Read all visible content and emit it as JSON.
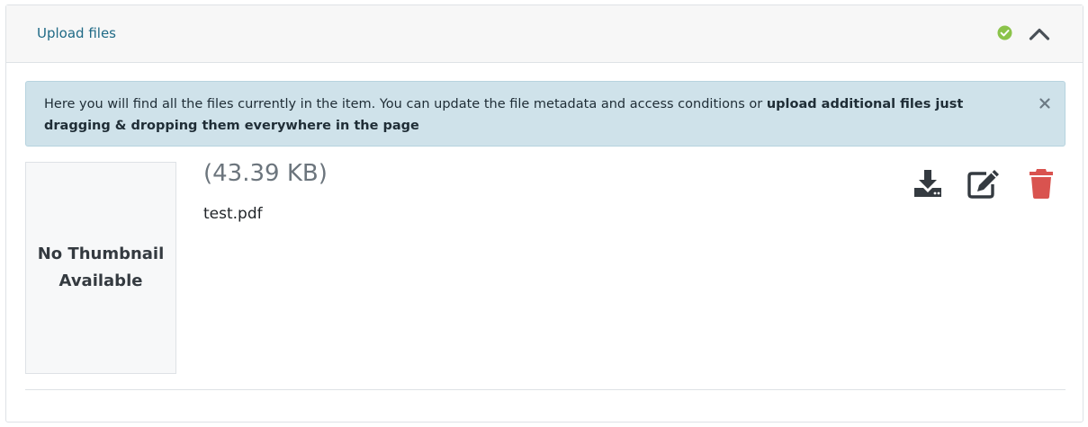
{
  "header": {
    "title": "Upload files",
    "status_icon": "check-circle-icon",
    "status_color": "#8bc34a",
    "collapse_icon": "chevron-up-icon"
  },
  "alert": {
    "text_normal": "Here you will find all the files currently in the item. You can update the file metadata and access conditions or ",
    "text_bold": "upload additional files just dragging & dropping them everywhere in the page",
    "close_icon": "close-icon",
    "background": "#cfe2ea"
  },
  "file": {
    "thumbnail_line1": "No Thumbnail",
    "thumbnail_line2": "Available",
    "size": "(43.39 KB)",
    "name": "test.pdf"
  },
  "actions": {
    "download_icon": "download-icon",
    "edit_icon": "edit-icon",
    "delete_icon": "trash-icon",
    "delete_color": "#d9534f"
  }
}
